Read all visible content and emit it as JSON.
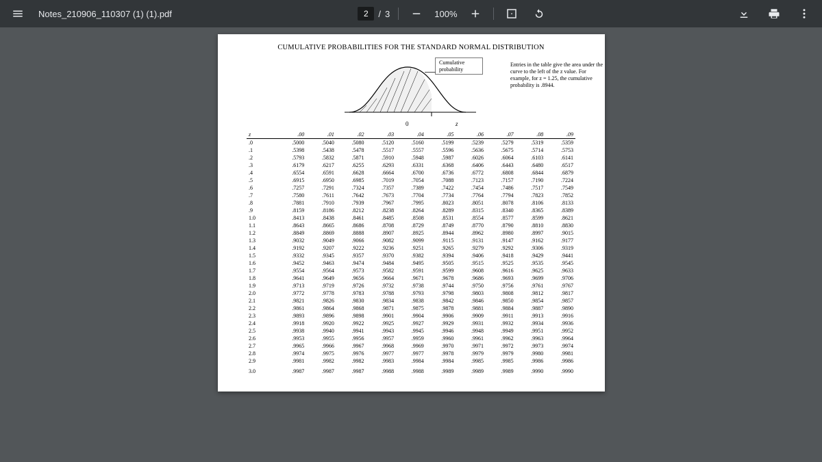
{
  "toolbar": {
    "filename": "Notes_210906_110307 (1) (1).pdf",
    "page_current": "2",
    "page_sep": "/",
    "page_total": "3",
    "zoom_level": "100%"
  },
  "doc": {
    "title": "CUMULATIVE PROBABILITIES FOR THE STANDARD NORMAL DISTRIBUTION",
    "annotation_box": "Cumulative\nprobability",
    "caption": "Entries in the table give the area under the curve to the left of the z value. For example, for z = 1.25, the cumulative probability is .8944.",
    "axis_zero": "0",
    "axis_z": "z",
    "headers": [
      "z",
      ".00",
      ".01",
      ".02",
      ".03",
      ".04",
      ".05",
      ".06",
      ".07",
      ".08",
      ".09"
    ],
    "rows": [
      [
        ".0",
        ".5000",
        ".5040",
        ".5080",
        ".5120",
        ".5160",
        ".5199",
        ".5239",
        ".5279",
        ".5319",
        ".5359"
      ],
      [
        ".1",
        ".5398",
        ".5438",
        ".5478",
        ".5517",
        ".5557",
        ".5596",
        ".5636",
        ".5675",
        ".5714",
        ".5753"
      ],
      [
        ".2",
        ".5793",
        ".5832",
        ".5871",
        ".5910",
        ".5948",
        ".5987",
        ".6026",
        ".6064",
        ".6103",
        ".6141"
      ],
      [
        ".3",
        ".6179",
        ".6217",
        ".6255",
        ".6293",
        ".6331",
        ".6368",
        ".6406",
        ".6443",
        ".6480",
        ".6517"
      ],
      [
        ".4",
        ".6554",
        ".6591",
        ".6628",
        ".6664",
        ".6700",
        ".6736",
        ".6772",
        ".6808",
        ".6844",
        ".6879"
      ],
      [
        ".5",
        ".6915",
        ".6950",
        ".6985",
        ".7019",
        ".7054",
        ".7088",
        ".7123",
        ".7157",
        ".7190",
        ".7224"
      ],
      [
        ".6",
        ".7257",
        ".7291",
        ".7324",
        ".7357",
        ".7389",
        ".7422",
        ".7454",
        ".7486",
        ".7517",
        ".7549"
      ],
      [
        ".7",
        ".7580",
        ".7611",
        ".7642",
        ".7673",
        ".7704",
        ".7734",
        ".7764",
        ".7794",
        ".7823",
        ".7852"
      ],
      [
        ".8",
        ".7881",
        ".7910",
        ".7939",
        ".7967",
        ".7995",
        ".8023",
        ".8051",
        ".8078",
        ".8106",
        ".8133"
      ],
      [
        ".9",
        ".8159",
        ".8186",
        ".8212",
        ".8238",
        ".8264",
        ".8289",
        ".8315",
        ".8340",
        ".8365",
        ".8389"
      ],
      [
        "1.0",
        ".8413",
        ".8438",
        ".8461",
        ".8485",
        ".8508",
        ".8531",
        ".8554",
        ".8577",
        ".8599",
        ".8621"
      ],
      [
        "1.1",
        ".8643",
        ".8665",
        ".8686",
        ".8708",
        ".8729",
        ".8749",
        ".8770",
        ".8790",
        ".8810",
        ".8830"
      ],
      [
        "1.2",
        ".8849",
        ".8869",
        ".8888",
        ".8907",
        ".8925",
        ".8944",
        ".8962",
        ".8980",
        ".8997",
        ".9015"
      ],
      [
        "1.3",
        ".9032",
        ".9049",
        ".9066",
        ".9082",
        ".9099",
        ".9115",
        ".9131",
        ".9147",
        ".9162",
        ".9177"
      ],
      [
        "1.4",
        ".9192",
        ".9207",
        ".9222",
        ".9236",
        ".9251",
        ".9265",
        ".9279",
        ".9292",
        ".9306",
        ".9319"
      ],
      [
        "1.5",
        ".9332",
        ".9345",
        ".9357",
        ".9370",
        ".9382",
        ".9394",
        ".9406",
        ".9418",
        ".9429",
        ".9441"
      ],
      [
        "1.6",
        ".9452",
        ".9463",
        ".9474",
        ".9484",
        ".9495",
        ".9505",
        ".9515",
        ".9525",
        ".9535",
        ".9545"
      ],
      [
        "1.7",
        ".9554",
        ".9564",
        ".9573",
        ".9582",
        ".9591",
        ".9599",
        ".9608",
        ".9616",
        ".9625",
        ".9633"
      ],
      [
        "1.8",
        ".9641",
        ".9649",
        ".9656",
        ".9664",
        ".9671",
        ".9678",
        ".9686",
        ".9693",
        ".9699",
        ".9706"
      ],
      [
        "1.9",
        ".9713",
        ".9719",
        ".9726",
        ".9732",
        ".9738",
        ".9744",
        ".9750",
        ".9756",
        ".9761",
        ".9767"
      ],
      [
        "2.0",
        ".9772",
        ".9778",
        ".9783",
        ".9788",
        ".9793",
        ".9798",
        ".9803",
        ".9808",
        ".9812",
        ".9817"
      ],
      [
        "2.1",
        ".9821",
        ".9826",
        ".9830",
        ".9834",
        ".9838",
        ".9842",
        ".9846",
        ".9850",
        ".9854",
        ".9857"
      ],
      [
        "2.2",
        ".9861",
        ".9864",
        ".9868",
        ".9871",
        ".9875",
        ".9878",
        ".9881",
        ".9884",
        ".9887",
        ".9890"
      ],
      [
        "2.3",
        ".9893",
        ".9896",
        ".9898",
        ".9901",
        ".9904",
        ".9906",
        ".9909",
        ".9911",
        ".9913",
        ".9916"
      ],
      [
        "2.4",
        ".9918",
        ".9920",
        ".9922",
        ".9925",
        ".9927",
        ".9929",
        ".9931",
        ".9932",
        ".9934",
        ".9936"
      ],
      [
        "2.5",
        ".9938",
        ".9940",
        ".9941",
        ".9943",
        ".9945",
        ".9946",
        ".9948",
        ".9949",
        ".9951",
        ".9952"
      ],
      [
        "2.6",
        ".9953",
        ".9955",
        ".9956",
        ".9957",
        ".9959",
        ".9960",
        ".9961",
        ".9962",
        ".9963",
        ".9964"
      ],
      [
        "2.7",
        ".9965",
        ".9966",
        ".9967",
        ".9968",
        ".9969",
        ".9970",
        ".9971",
        ".9972",
        ".9973",
        ".9974"
      ],
      [
        "2.8",
        ".9974",
        ".9975",
        ".9976",
        ".9977",
        ".9977",
        ".9978",
        ".9979",
        ".9979",
        ".9980",
        ".9981"
      ],
      [
        "2.9",
        ".9981",
        ".9982",
        ".9982",
        ".9983",
        ".9984",
        ".9984",
        ".9985",
        ".9985",
        ".9986",
        ".9986"
      ],
      [
        "3.0",
        ".9987",
        ".9987",
        ".9987",
        ".9988",
        ".9988",
        ".9989",
        ".9989",
        ".9989",
        ".9990",
        ".9990"
      ]
    ],
    "group_breaks": [
      5,
      10,
      15,
      20,
      25,
      30
    ]
  }
}
